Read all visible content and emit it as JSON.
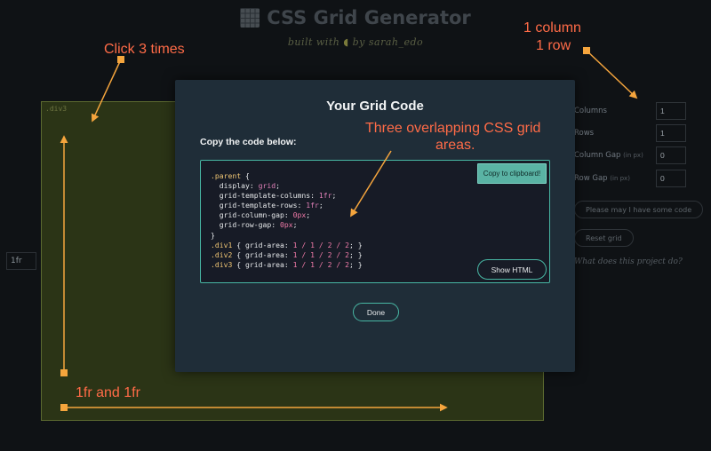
{
  "background": {
    "title": "CSS Grid Generator",
    "subtitle_prefix": "built with",
    "subtitle_suffix": "by sarah_edo",
    "grid_cell_label": ".div3",
    "row_input_value": "1fr",
    "controls": {
      "columns_label": "Columns",
      "columns_value": "1",
      "rows_label": "Rows",
      "rows_value": "1",
      "column_gap_label": "Column Gap",
      "column_gap_unit": "(in px)",
      "column_gap_value": "0",
      "row_gap_label": "Row Gap",
      "row_gap_unit": "(in px)",
      "row_gap_value": "0",
      "code_button": "Please may I have some code",
      "reset_button": "Reset grid",
      "help_link": "What does this project do?"
    }
  },
  "modal": {
    "title": "Your Grid Code",
    "instructions": "Copy the code below:",
    "copy_button": "Copy to clipboard!",
    "show_html_button": "Show HTML",
    "done_button": "Done",
    "code": {
      "parent_selector": ".parent",
      "open_brace": " {",
      "close_brace": "}",
      "declarations": [
        {
          "prop": "display",
          "value": "grid"
        },
        {
          "prop": "grid-template-columns",
          "value": "1fr"
        },
        {
          "prop": "grid-template-rows",
          "value": "1fr"
        },
        {
          "prop": "grid-column-gap",
          "value": "0px"
        },
        {
          "prop": "grid-row-gap",
          "value": "0px"
        }
      ],
      "children": [
        {
          "selector": ".div1",
          "area": "1 / 1 / 2 / 2"
        },
        {
          "selector": ".div2",
          "area": "1 / 1 / 2 / 2"
        },
        {
          "selector": ".div3",
          "area": "1 / 1 / 2 / 2"
        }
      ]
    }
  },
  "annotations": {
    "click_note": "Click 3 times",
    "grid_note_line1": "1 column",
    "grid_note_line2": "1 row",
    "overlap_note_line1": "Three overlapping CSS grid",
    "overlap_note_line2": "areas.",
    "fr_note": "1fr and 1fr",
    "color": "#ff6b47",
    "marker_color": "#f5a53d"
  }
}
